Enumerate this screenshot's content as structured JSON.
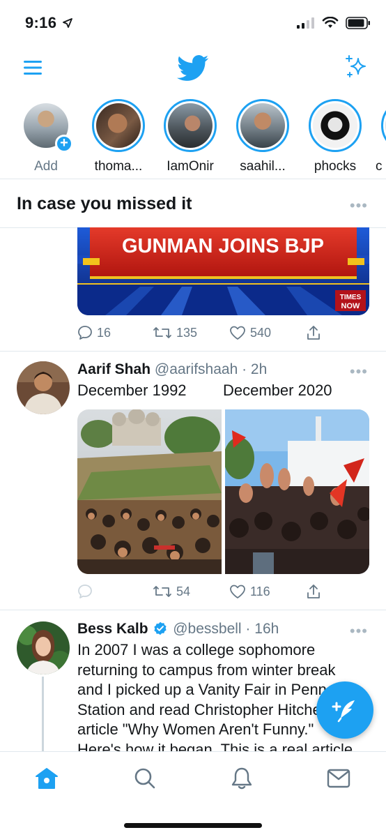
{
  "status_bar": {
    "time": "9:16"
  },
  "fleets": [
    {
      "name": "Add"
    },
    {
      "name": "thoma..."
    },
    {
      "name": "IamOnir"
    },
    {
      "name": "saahil..."
    },
    {
      "name": "phocks"
    },
    {
      "name": "c"
    }
  ],
  "section": {
    "title": "In case you missed it",
    "more": "•••"
  },
  "tweet1": {
    "media_text": "GUNMAN JOINS BJP",
    "media_badge_1": "TIMES",
    "media_badge_2": "NOW",
    "replies": "16",
    "retweets": "135",
    "likes": "540"
  },
  "tweet2": {
    "name": "Aarif Shah",
    "handle": "@aarifshaah · 2h",
    "text_left": "December 1992",
    "text_right": "December 2020",
    "more": "•••",
    "retweets": "54",
    "likes": "116"
  },
  "tweet3": {
    "name": "Bess Kalb",
    "handle": "@bessbell · 16h",
    "more": "•••",
    "text": "In 2007 I was a college sophomore returning to campus from winter break and I picked up a Vanity Fair in Penn Station and read Christopher Hitchens' article \"Why Women Aren't Funny.\" Here's how it began. This is a real article"
  },
  "colors": {
    "accent": "#1da1f2",
    "muted": "#657786",
    "divider": "#e1e8ed"
  }
}
